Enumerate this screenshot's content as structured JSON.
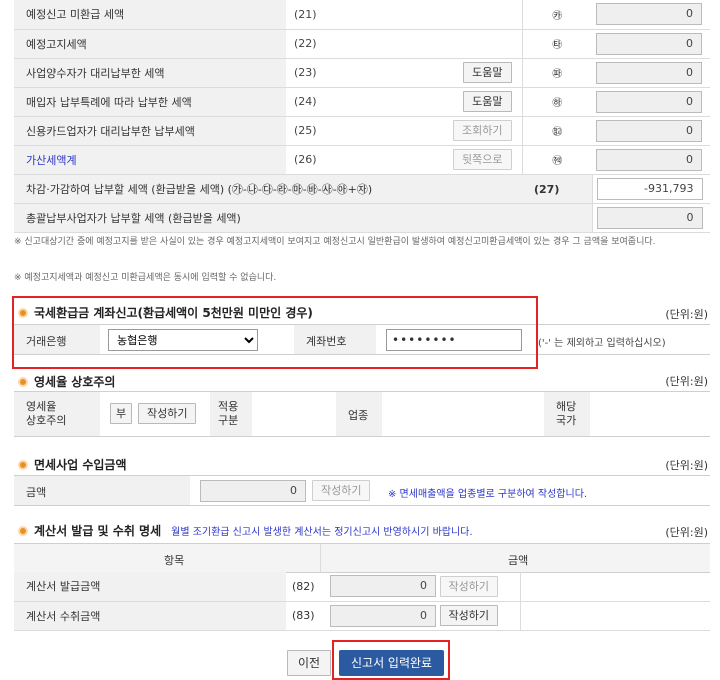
{
  "rows": [
    {
      "label": "예정신고 미환급 세액",
      "code": "(21)",
      "button": "",
      "circle": "㉸",
      "value": "0"
    },
    {
      "label": "예정고지세액",
      "code": "(22)",
      "button": "",
      "circle": "㉹",
      "value": "0"
    },
    {
      "label": "사업양수자가 대리납부한 세액",
      "code": "(23)",
      "button": "도움말",
      "circle": "㉺",
      "value": "0"
    },
    {
      "label": "매입자 납부특례에 따라 납부한 세액",
      "code": "(24)",
      "button": "도움말",
      "circle": "㉻",
      "value": "0"
    },
    {
      "label": "신용카드업자가 대리납부한 납부세액",
      "code": "(25)",
      "button": "조회하기",
      "circle": "㉼",
      "value": "0"
    },
    {
      "label": "가산세액계",
      "code": "(26)",
      "button": "뒷쪽으로",
      "circle": "㉽",
      "value": "0"
    }
  ],
  "total_row": {
    "label": "차감·가감하여 납부할 세액 (환급받을 세액) (㉮-㉯-㉰-㉱-㉲-㉳-㉴-㉵+㉶)",
    "code": "(27)",
    "value": "-931,793"
  },
  "group_row": {
    "label": "총괄납부사업자가 납부할 세액 (환급받을 세액)",
    "value": "0"
  },
  "notes": [
    "※ 신고대상기간 중에 예정고지를 받은 사실이 있는 경우 예정고지세액이 보여지고 예정신고시 일반환급이 발생하여 예정신고미환급세액이 있는 경우 그 금액을 보여줍니다.",
    "※ 예정고지세액과 예정신고 미환급세액은 동시에 입력할 수 없습니다."
  ],
  "refund": {
    "title": "국세환급금 계좌신고(환급세액이 5천만원 미만인 경우)",
    "unit": "(단위:원)",
    "bank_label": "거래은행",
    "bank_value": "농협은행",
    "account_label": "계좌번호",
    "account_value": "••••••••",
    "hint": "('-' 는 제외하고 입력하십시오)"
  },
  "zero_rate": {
    "title": "영세율 상호주의",
    "unit": "(단위:원)",
    "label_line1": "영세율",
    "label_line2": "상호주의",
    "answer": "부",
    "write_button": "작성하기",
    "apply_line1": "적용",
    "apply_line2": "구분",
    "industry_label": "업종",
    "country_line1": "해당",
    "country_line2": "국가"
  },
  "exempt": {
    "title": "면세사업 수입금액",
    "unit": "(단위:원)",
    "amount_label": "금액",
    "amount_value": "0",
    "write_button": "작성하기",
    "note": "※ 면세매출액을 업종별로 구분하여 작성합니다."
  },
  "invoice": {
    "title": "계산서 발급 및 수취 명세",
    "notice": "월별 조기환급 신고시 발생한 계산서는 정기신고시 반영하시기 바랍니다.",
    "unit": "(단위:원)",
    "col_item": "항목",
    "col_amount": "금액",
    "rows": [
      {
        "label": "계산서 발급금액",
        "code": "(82)",
        "value": "0",
        "button": "작성하기"
      },
      {
        "label": "계산서 수취금액",
        "code": "(83)",
        "value": "0",
        "button": "작성하기"
      }
    ]
  },
  "footer": {
    "prev_button": "이전",
    "submit_button": "신고서 입력완료"
  }
}
